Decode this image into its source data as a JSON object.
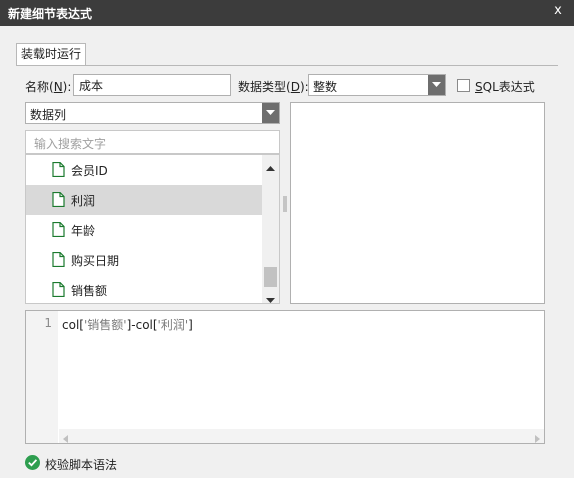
{
  "window": {
    "title": "新建细节表达式",
    "close": "x"
  },
  "tabs": [
    {
      "label": "装载时运行"
    }
  ],
  "name_field": {
    "label_prefix": "名称(",
    "hotkey": "N",
    "label_suffix": "):",
    "value": "成本"
  },
  "datatype": {
    "label_prefix": "数据类型(",
    "hotkey": "D",
    "label_suffix": "):",
    "value": "整数"
  },
  "sql_checkbox": {
    "hotkey": "S",
    "label_rest": "QL表达式",
    "checked": false
  },
  "source_select": {
    "value": "数据列"
  },
  "search": {
    "placeholder": "输入搜索文字"
  },
  "field_list": [
    {
      "label": "会员ID",
      "selected": false
    },
    {
      "label": "利润",
      "selected": true
    },
    {
      "label": "年龄",
      "selected": false
    },
    {
      "label": "购买日期",
      "selected": false
    },
    {
      "label": "销售额",
      "selected": false
    }
  ],
  "editor": {
    "line_number": "1",
    "code_parts": [
      "col[",
      "'销售额'",
      "]-col[",
      "'利润'",
      "]"
    ]
  },
  "validate": {
    "label": "校验脚本语法"
  },
  "colors": {
    "titlebar": "#3c3c3c",
    "accent_green": "#2e9e4f",
    "icon_green": "#1b7a2e"
  }
}
